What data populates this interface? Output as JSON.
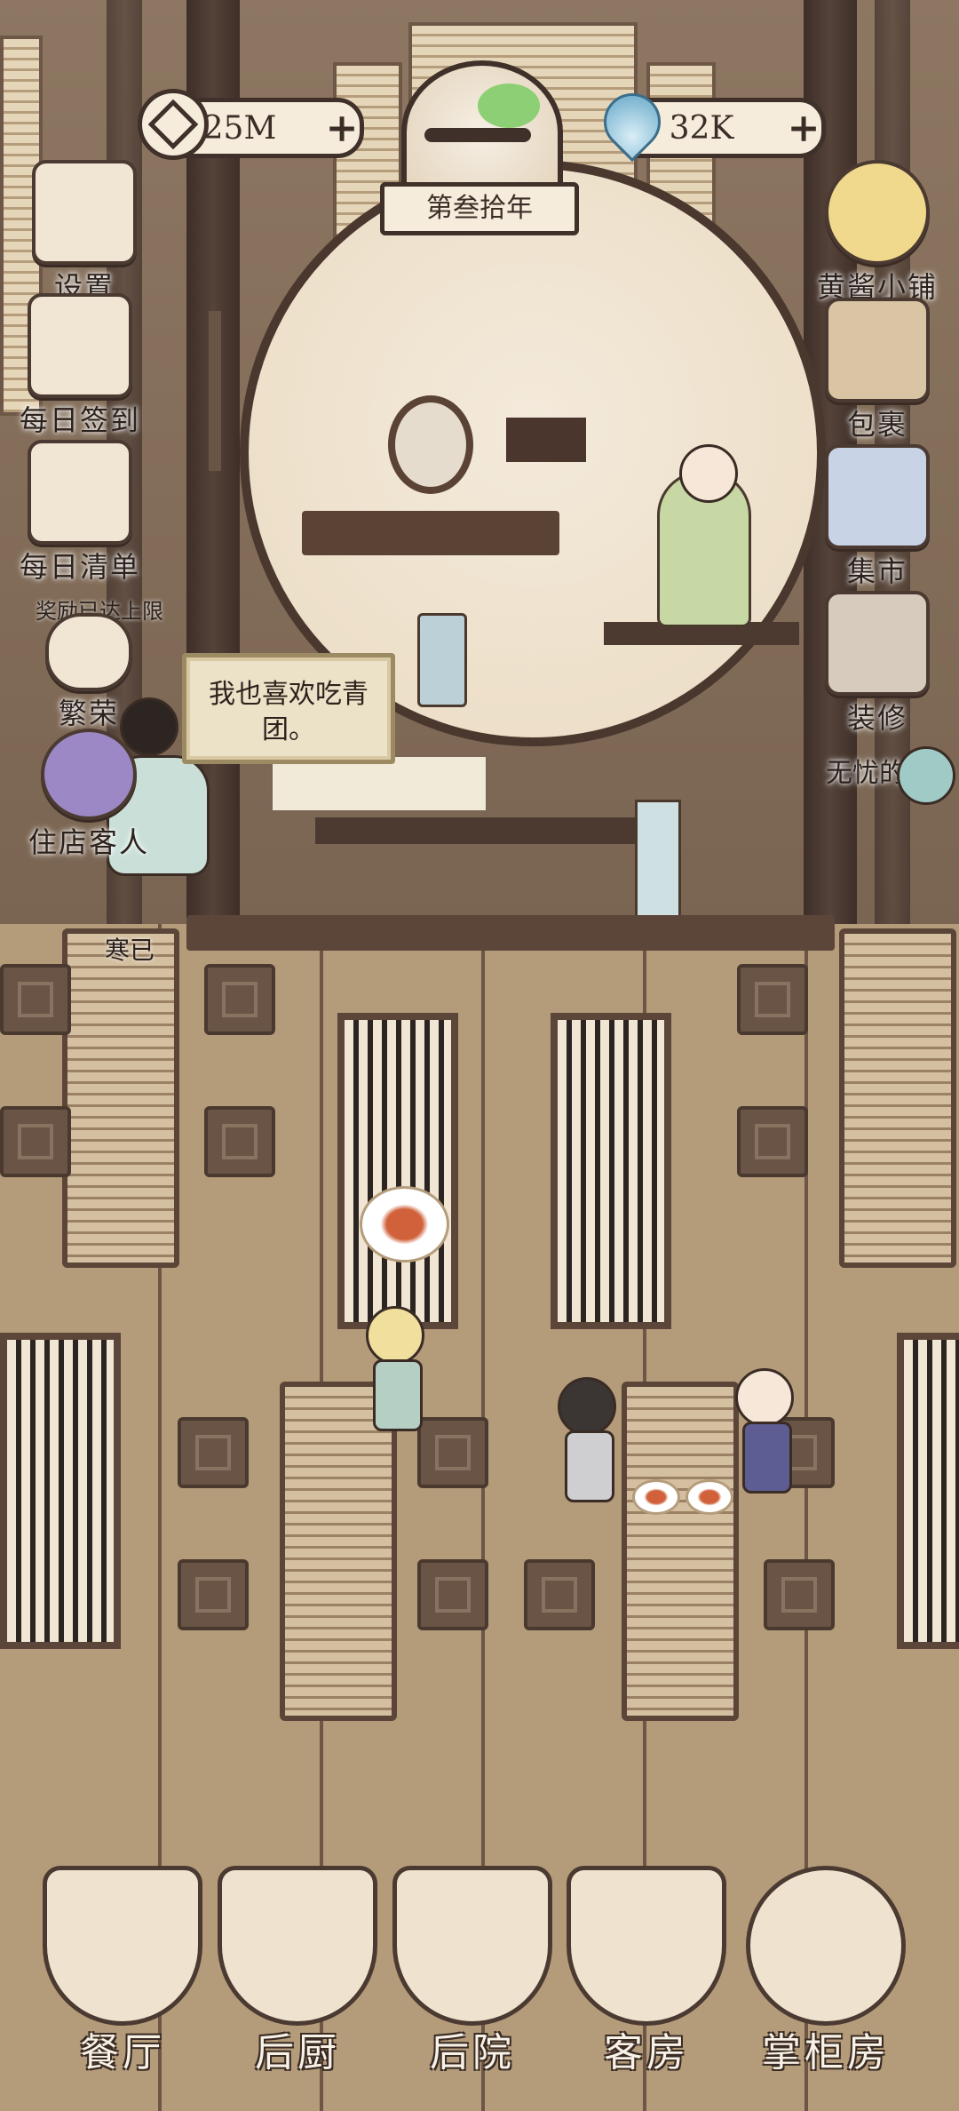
{
  "hud": {
    "coins": "25M",
    "gems": "32K",
    "year": "第叁拾年"
  },
  "left_menu": [
    {
      "label": "设置",
      "icon": "settings-cube-icon"
    },
    {
      "label": "每日签到",
      "icon": "daily-checkin-scroll-icon"
    },
    {
      "label": "每日清单",
      "icon": "daily-list-book-icon"
    },
    {
      "label": "繁荣",
      "icon": "prosperity-coins-icon"
    },
    {
      "label": "住店客人",
      "icon": "guest-bag-icon"
    }
  ],
  "right_menu": [
    {
      "label": "黄酱小铺",
      "icon": "shop-keeper-icon"
    },
    {
      "label": "包裹",
      "icon": "basket-bag-icon"
    },
    {
      "label": "集市",
      "icon": "market-stall-icon"
    },
    {
      "label": "装修",
      "icon": "hammer-renovate-icon"
    },
    {
      "label": "无忧的如",
      "icon": "lotus-leaf-icon"
    }
  ],
  "notices": {
    "limit_text": "奖励已达上限",
    "dialog_text": "我也喜欢吃青团。",
    "guest_name": "寒已"
  },
  "bottom_nav": [
    {
      "label": "餐厅",
      "icon": "restaurant-food-icon"
    },
    {
      "label": "后厨",
      "icon": "kitchen-crane-icon"
    },
    {
      "label": "后院",
      "icon": "backyard-animals-icon"
    },
    {
      "label": "客房",
      "icon": "guest-room-icon"
    },
    {
      "label": "掌柜房",
      "icon": "manager-room-icon"
    }
  ]
}
